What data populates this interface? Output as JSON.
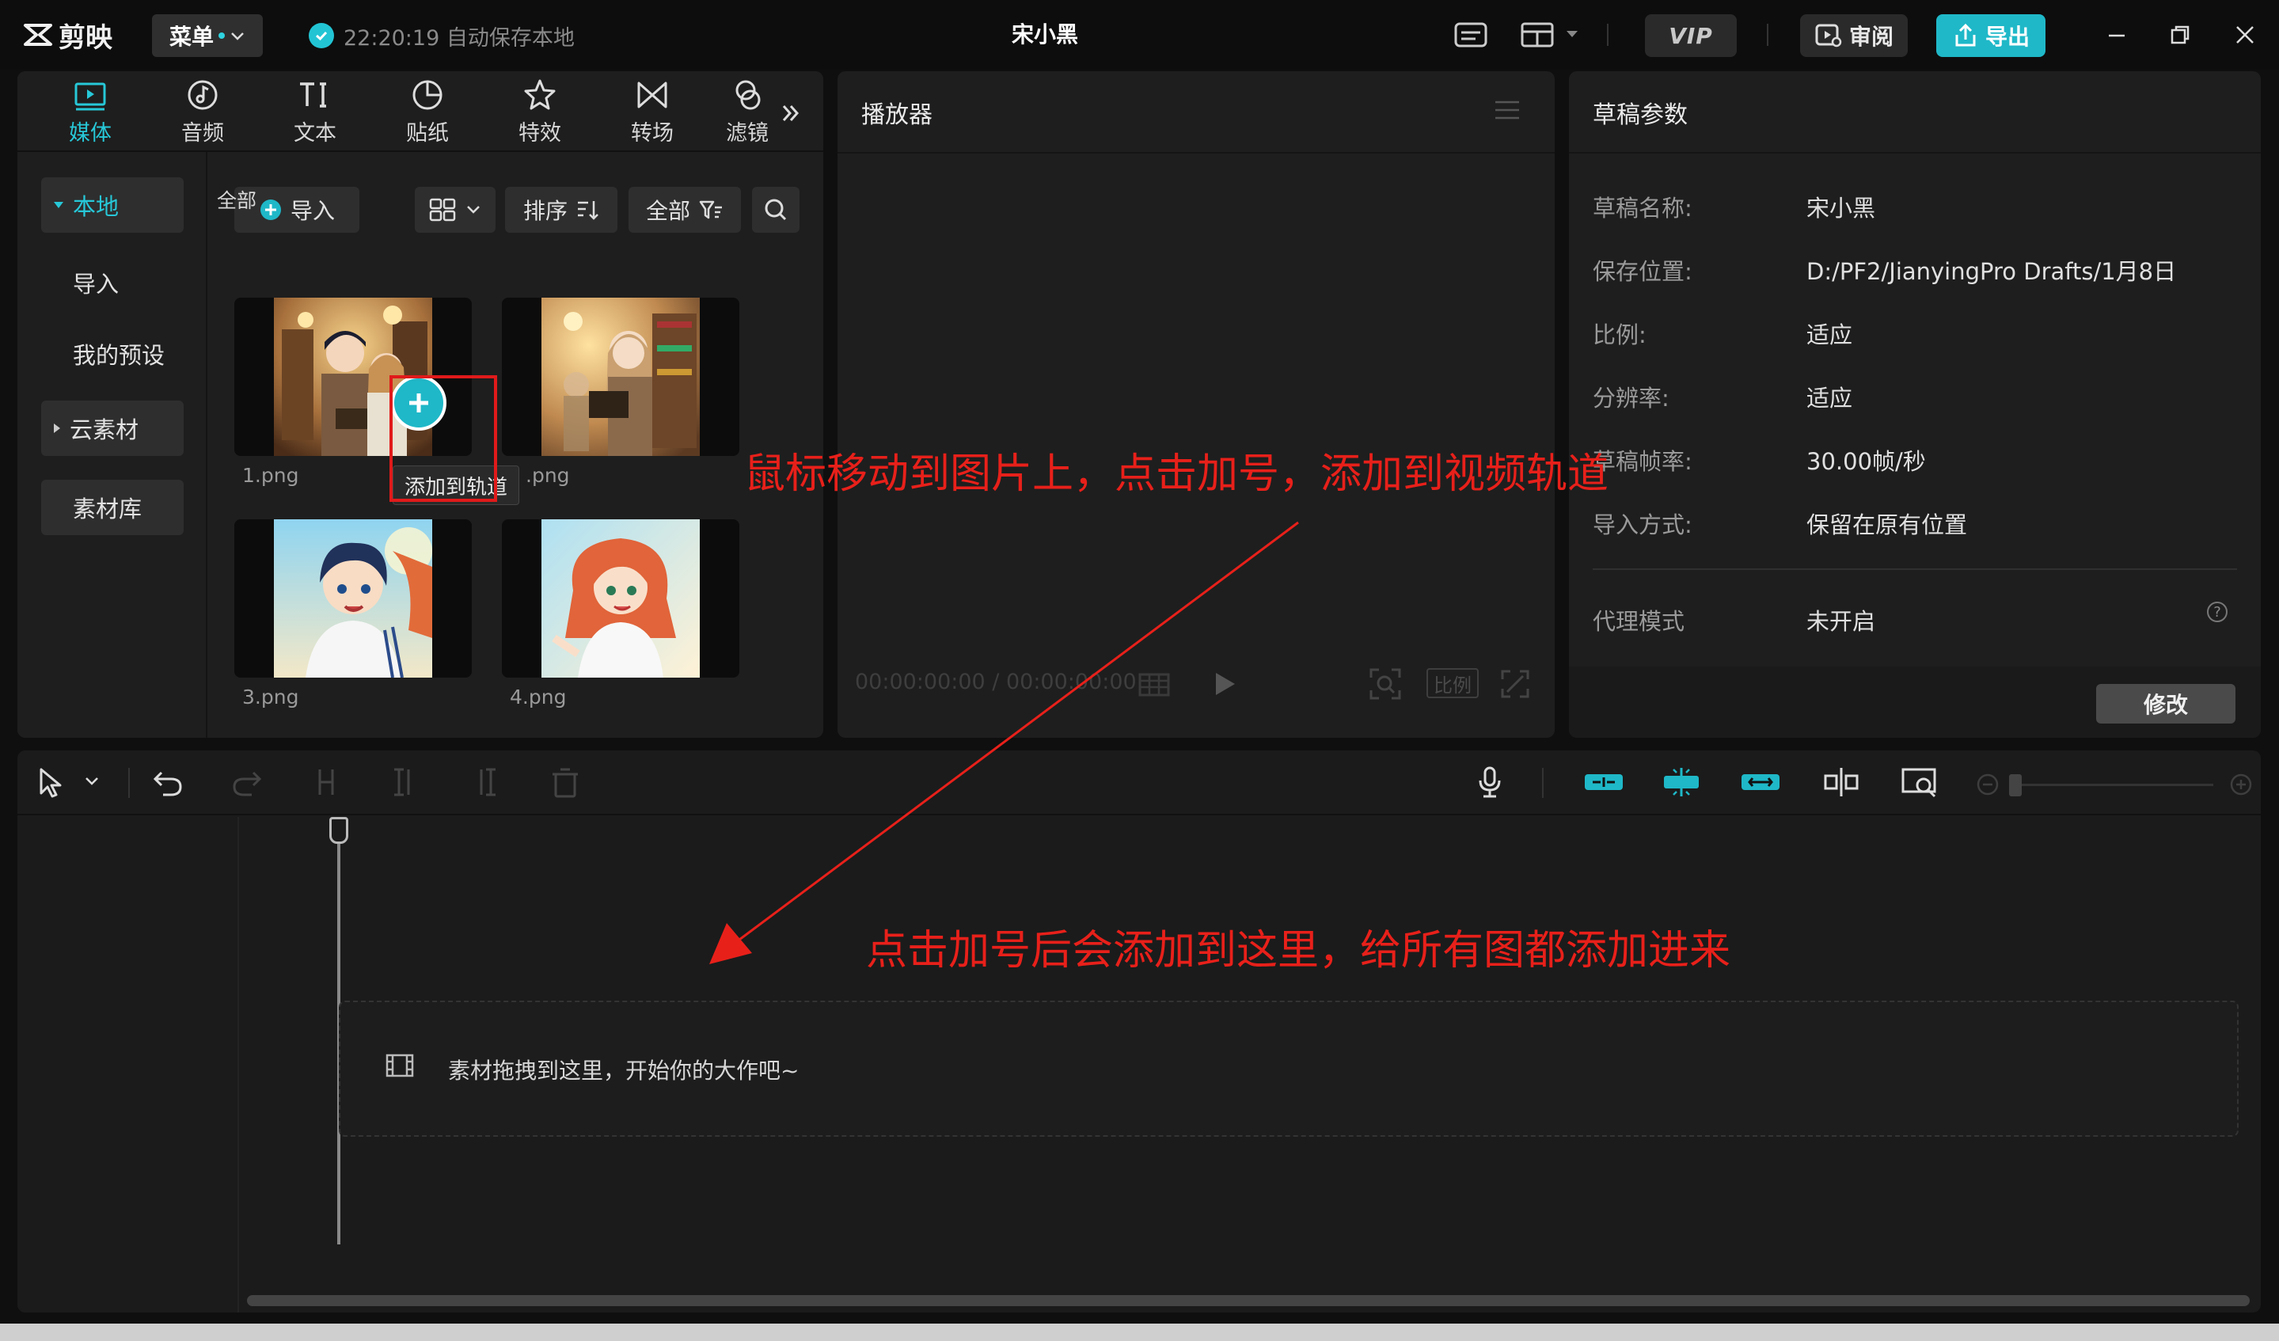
{
  "app": {
    "logo_text": "剪映",
    "menu_label": "菜单",
    "autosave": "22:20:19 自动保存本地",
    "project_title": "宋小黑",
    "vip_label": "VIP",
    "review_label": "审阅",
    "export_label": "导出"
  },
  "media_tabs": [
    {
      "label": "媒体",
      "icon": "media-icon"
    },
    {
      "label": "音频",
      "icon": "audio-icon"
    },
    {
      "label": "文本",
      "icon": "text-icon"
    },
    {
      "label": "贴纸",
      "icon": "sticker-icon"
    },
    {
      "label": "特效",
      "icon": "effects-icon"
    },
    {
      "label": "转场",
      "icon": "transition-icon"
    },
    {
      "label": "滤镜",
      "icon": "filter-icon"
    }
  ],
  "sidebar": {
    "items": [
      {
        "label": "本地"
      },
      {
        "label": "导入"
      },
      {
        "label": "我的预设"
      },
      {
        "label": "云素材"
      },
      {
        "label": "素材库"
      }
    ]
  },
  "media_toolbar": {
    "import_label": "导入",
    "sort_label": "排序",
    "filter_label": "全部"
  },
  "media_grid": {
    "section_label": "全部",
    "items": [
      {
        "name": "1.png"
      },
      {
        "name": "2.png"
      },
      {
        "name": "3.png"
      },
      {
        "name": "4.png"
      }
    ],
    "hover_tooltip": "添加到轨道"
  },
  "player": {
    "title": "播放器",
    "timecode": "00:00:00:00 / 00:00:00:00",
    "ratio_label": "比例"
  },
  "draft_params": {
    "title": "草稿参数",
    "rows": [
      {
        "label": "草稿名称:",
        "value": "宋小黑"
      },
      {
        "label": "保存位置:",
        "value": "D:/PF2/JianyingPro Drafts/1月8日"
      },
      {
        "label": "比例:",
        "value": "适应"
      },
      {
        "label": "分辨率:",
        "value": "适应"
      },
      {
        "label": "草稿帧率:",
        "value": "30.00帧/秒"
      },
      {
        "label": "导入方式:",
        "value": "保留在原有位置"
      }
    ],
    "proxy_label": "代理模式",
    "proxy_value": "未开启",
    "modify_label": "修改"
  },
  "timeline": {
    "drop_hint": "素材拖拽到这里，开始你的大作吧~"
  },
  "annotations": {
    "top": "鼠标移动到图片上，点击加号，添加到视频轨道",
    "bottom": "点击加号后会添加到这里，给所有图都添加进来"
  },
  "colors": {
    "accent": "#1fb8c8",
    "annotation": "#e8201a"
  }
}
